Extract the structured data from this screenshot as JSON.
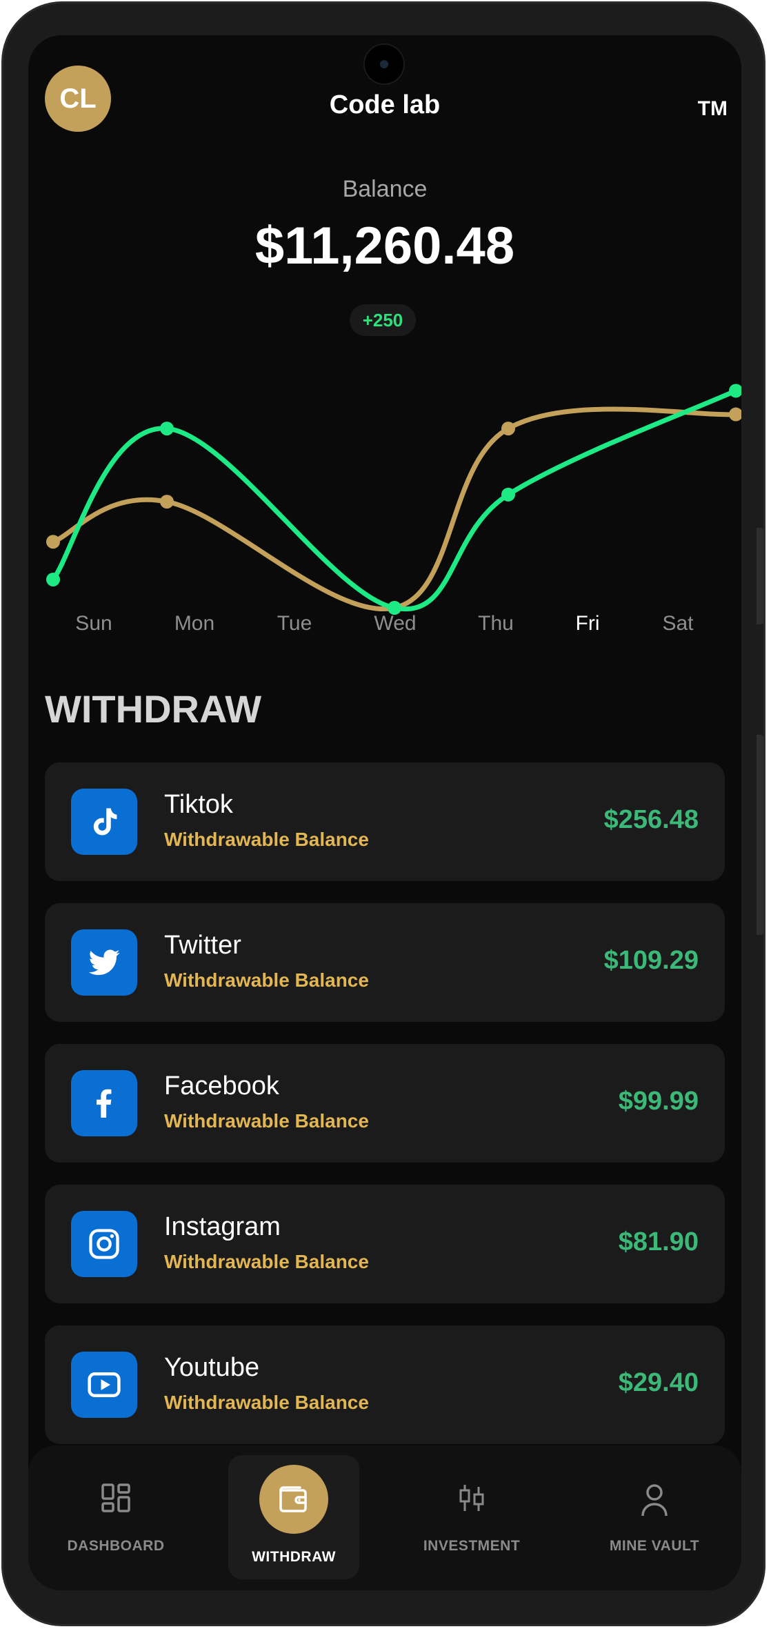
{
  "header": {
    "avatar_initials": "CL",
    "app_title": "Code lab",
    "trademark": "TM"
  },
  "balance": {
    "label": "Balance",
    "amount": "$11,260.48",
    "change": "+250"
  },
  "chart_data": {
    "type": "line",
    "categories": [
      "Sun",
      "Mon",
      "Tue",
      "Wed",
      "Thu",
      "Fri",
      "Sat"
    ],
    "selected_category": "Fri",
    "grid": false,
    "series": [
      {
        "color": "#1de985",
        "points": [
          [
            0,
            12
          ],
          [
            1,
            76
          ],
          [
            3,
            0
          ],
          [
            4,
            48
          ],
          [
            6,
            92
          ]
        ]
      },
      {
        "color": "#c4a15a",
        "points": [
          [
            0,
            28
          ],
          [
            1,
            45
          ],
          [
            3,
            0
          ],
          [
            4,
            76
          ],
          [
            6,
            82
          ]
        ]
      }
    ],
    "ylim": [
      0,
      100
    ]
  },
  "withdraw": {
    "title": "WITHDRAW",
    "items": [
      {
        "name": "Tiktok",
        "subtitle": "Withdrawable Balance",
        "amount": "$256.48",
        "icon": "tiktok-icon"
      },
      {
        "name": "Twitter",
        "subtitle": "Withdrawable Balance",
        "amount": "$109.29",
        "icon": "twitter-icon"
      },
      {
        "name": "Facebook",
        "subtitle": "Withdrawable Balance",
        "amount": "$99.99",
        "icon": "facebook-icon"
      },
      {
        "name": "Instagram",
        "subtitle": "Withdrawable Balance",
        "amount": "$81.90",
        "icon": "instagram-icon"
      },
      {
        "name": "Youtube",
        "subtitle": "Withdrawable Balance",
        "amount": "$29.40",
        "icon": "youtube-icon"
      }
    ]
  },
  "nav": {
    "items": [
      {
        "label": "DASHBOARD",
        "icon": "dashboard-icon"
      },
      {
        "label": "WITHDRAW",
        "icon": "wallet-icon",
        "active": true
      },
      {
        "label": "INVESTMENT",
        "icon": "candlestick-icon"
      },
      {
        "label": "MINE VAULT",
        "icon": "user-icon"
      }
    ]
  },
  "colors": {
    "accent_gold": "#c4a15a",
    "accent_green": "#1de985",
    "amount_green": "#3cb878",
    "subtitle_yellow": "#e2b653",
    "icon_blue": "#0a6fd3"
  }
}
